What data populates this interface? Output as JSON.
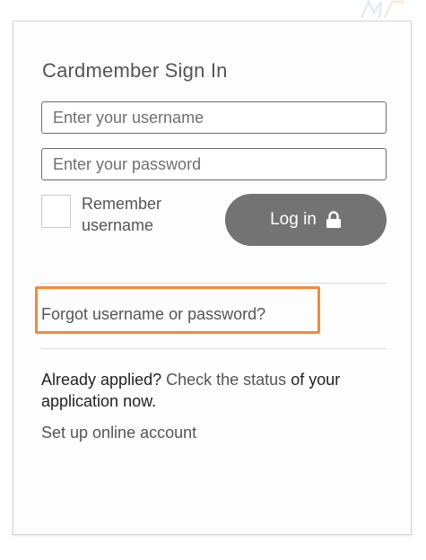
{
  "signin": {
    "title": "Cardmember Sign In",
    "username_placeholder": "Enter your username",
    "password_placeholder": "Enter your password",
    "remember_label": "Remember username",
    "login_label": "Log in",
    "login_icon": "lock-icon",
    "forgot_link": "Forgot username or password?",
    "applied_prefix": "Already applied? ",
    "check_status_link": "Check the status",
    "applied_suffix": " of your application now.",
    "setup_link": "Set up online account"
  },
  "colors": {
    "button_bg": "#737373",
    "highlight_border": "#f28a3a",
    "text": "#555555"
  }
}
